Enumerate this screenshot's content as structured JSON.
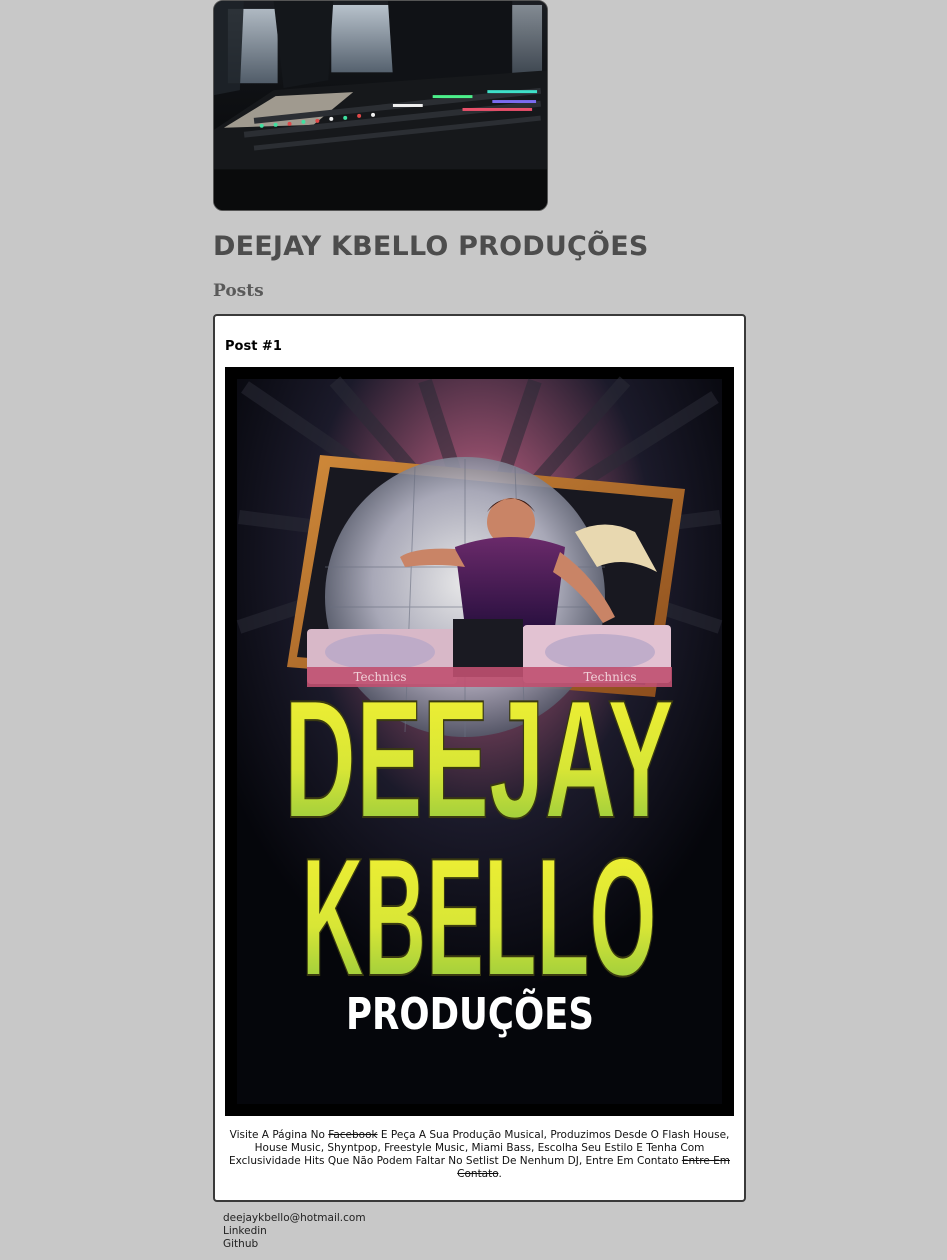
{
  "site": {
    "title": "DEEJAY KBELLO PRODUÇÕES",
    "section_title": "Posts"
  },
  "post": {
    "title": "Post #1",
    "poster": {
      "line1": "DEEJAY",
      "line2": "KBELLO",
      "line3": "PRODUÇÕES",
      "deck_brand": "Technics"
    },
    "text": {
      "part1": "Visite A Página No ",
      "strike1": "Facebook",
      "part2": " E Peça A Sua Produção Musical, Produzimos Desde O Flash House, House Music, Shyntpop, Freestyle Music, Miami Bass, Escolha Seu Estilo E Tenha Com Exclusividade Hits Que Não Podem Faltar No Setlist De Nenhum DJ, Entre Em Contato ",
      "strike2": "Entre Em Contato",
      "part3": "."
    }
  },
  "footer": {
    "email": "deejaykbello@hotmail.com",
    "linkedin": "Linkedin",
    "github": "Github"
  },
  "colors": {
    "background": "#c8c8c8",
    "card": "#ffffff",
    "title_text": "#4d4d4d",
    "poster_yellow": "#f2f02a",
    "poster_green": "#8cc63f"
  }
}
